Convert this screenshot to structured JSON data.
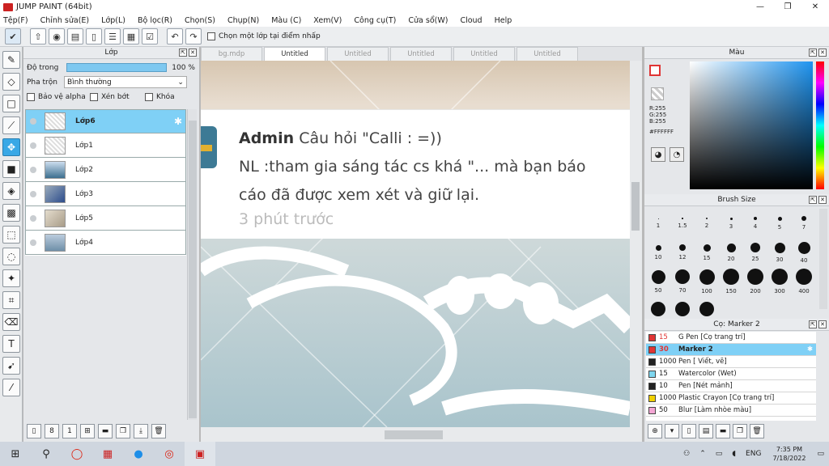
{
  "window": {
    "title": "JUMP PAINT (64bit)",
    "minimize": "—",
    "restore": "❐",
    "close": "✕"
  },
  "menu": [
    "Tệp(F)",
    "Chỉnh sửa(E)",
    "Lớp(L)",
    "Bộ lọc(R)",
    "Chọn(S)",
    "Chụp(N)",
    "Màu (C)",
    "Xem(V)",
    "Công cụ(T)",
    "Cửa sổ(W)",
    "Cloud",
    "Help"
  ],
  "toolbar": {
    "checkbox_label": "Chọn một lớp tại điểm nhấp"
  },
  "layer_panel": {
    "title": "Lớp",
    "opacity_label": "Độ trong",
    "opacity_value": "100 %",
    "opacity": 1.0,
    "blend_label": "Pha trộn",
    "blend_value": "Bình thường",
    "protect_alpha": "Bảo vệ alpha",
    "clip": "Xén bớt",
    "lock": "Khóa",
    "layers": [
      {
        "name": "Lớp6",
        "selected": true
      },
      {
        "name": "Lớp1",
        "selected": false
      },
      {
        "name": "Lớp2",
        "selected": false
      },
      {
        "name": "Lớp3",
        "selected": false
      },
      {
        "name": "Lớp5",
        "selected": false
      },
      {
        "name": "Lớp4",
        "selected": false
      }
    ]
  },
  "tabs": [
    {
      "label": "bg.mdp",
      "active": false
    },
    {
      "label": "Untitled",
      "active": true
    },
    {
      "label": "Untitled",
      "active": false
    },
    {
      "label": "Untitled",
      "active": false
    },
    {
      "label": "Untitled",
      "active": false
    },
    {
      "label": "Untitled",
      "active": false
    }
  ],
  "notification": {
    "author": "Admin",
    "line1_rest": " Câu hỏi \"Calli : =))",
    "line2": "NL :tham gia sáng tác cs khá \"... mà bạn báo",
    "line3": "cáo đã được xem xét và giữ lại.",
    "time": "3 phút trước"
  },
  "color_panel": {
    "title": "Màu",
    "r": "R:255",
    "g": "G:255",
    "b": "B:255",
    "hex": "#FFFFFF"
  },
  "brush_panel": {
    "title": "Brush Size",
    "sizes": [
      "1",
      "1.5",
      "2",
      "3",
      "4",
      "5",
      "7",
      "10",
      "12",
      "15",
      "20",
      "25",
      "30",
      "40",
      "50",
      "70",
      "100",
      "150",
      "200",
      "300",
      "400",
      "",
      "",
      ""
    ]
  },
  "marker_panel": {
    "title": "Cọ: Marker 2",
    "items": [
      {
        "size": "15",
        "name": "G Pen [Cọ trang trí]",
        "color": "#e03535",
        "selected": false
      },
      {
        "size": "30",
        "name": "Marker 2",
        "color": "#e03535",
        "selected": true
      },
      {
        "size": "1000",
        "name": "Pen [ Viết, vẽ]",
        "color": "#222222",
        "selected": false
      },
      {
        "size": "15",
        "name": "Watercolor (Wet)",
        "color": "#7fd6ee",
        "selected": false
      },
      {
        "size": "10",
        "name": "Pen [Nét mảnh]",
        "color": "#222222",
        "selected": false
      },
      {
        "size": "1000",
        "name": "Plastic Crayon [Cọ trang trí]",
        "color": "#f0d000",
        "selected": false
      },
      {
        "size": "50",
        "name": "Blur [Làm nhòe màu]",
        "color": "#f4a6d4",
        "selected": false
      }
    ]
  },
  "taskbar": {
    "lang": "ENG",
    "time": "7:35 PM",
    "date": "7/18/2022"
  }
}
